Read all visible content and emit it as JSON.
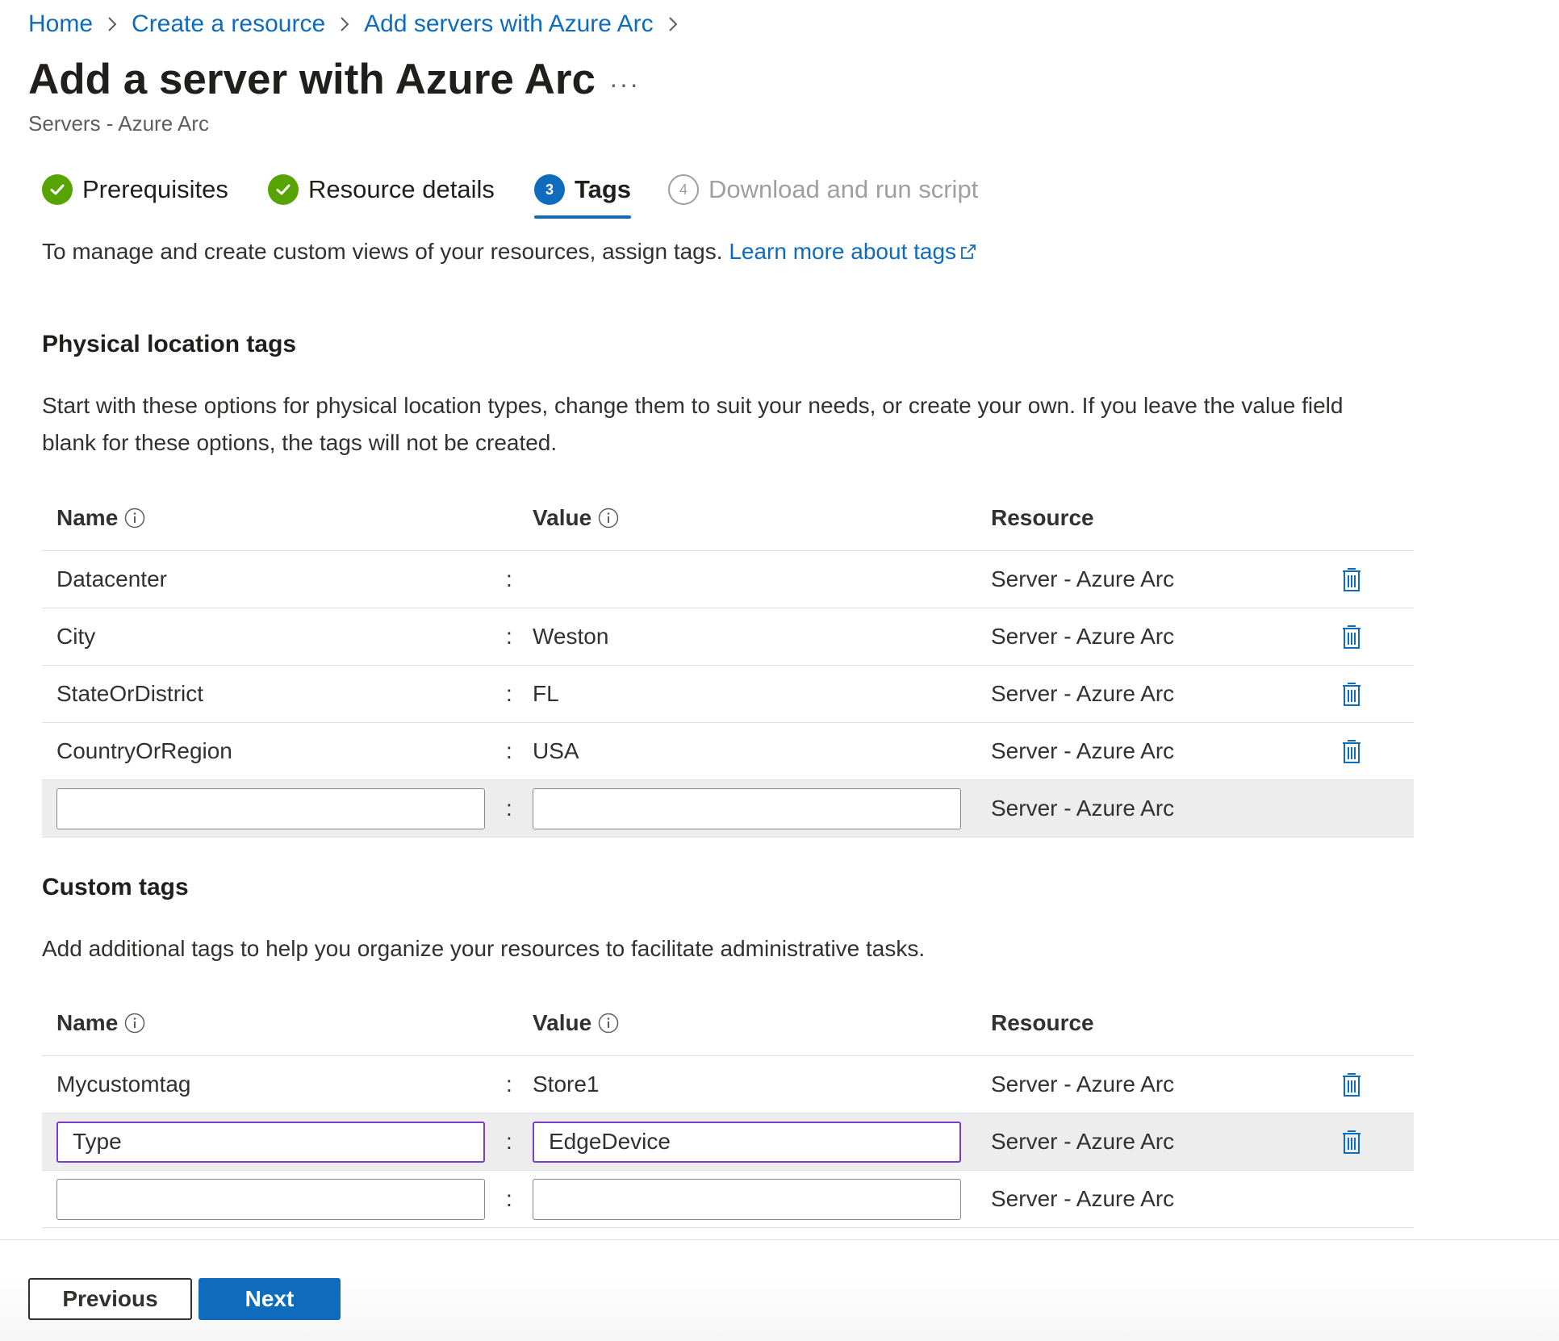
{
  "breadcrumb": {
    "items": [
      "Home",
      "Create a resource",
      "Add servers with Azure Arc"
    ]
  },
  "page": {
    "title": "Add a server with Azure Arc",
    "more": "···",
    "subtitle": "Servers - Azure Arc"
  },
  "steps": [
    {
      "label": "Prerequisites",
      "state": "done"
    },
    {
      "label": "Resource details",
      "state": "done"
    },
    {
      "label": "Tags",
      "state": "active",
      "number": "3"
    },
    {
      "label": "Download and run script",
      "state": "pending",
      "number": "4"
    }
  ],
  "intro": {
    "text": "To manage and create custom views of your resources, assign tags.",
    "link": "Learn more about tags"
  },
  "physical": {
    "title": "Physical location tags",
    "description": "Start with these options for physical location types, change them to suit your needs, or create your own. If you leave the value field blank for these options, the tags will not be created.",
    "headers": {
      "name": "Name",
      "value": "Value",
      "resource": "Resource"
    },
    "rows": [
      {
        "name": "Datacenter",
        "value": "",
        "resource": "Server - Azure Arc"
      },
      {
        "name": "City",
        "value": "Weston",
        "resource": "Server - Azure Arc"
      },
      {
        "name": "StateOrDistrict",
        "value": "FL",
        "resource": "Server - Azure Arc"
      },
      {
        "name": "CountryOrRegion",
        "value": "USA",
        "resource": "Server - Azure Arc"
      }
    ],
    "new_row": {
      "name": "",
      "value": "",
      "resource": "Server - Azure Arc"
    }
  },
  "custom": {
    "title": "Custom tags",
    "description": "Add additional tags to help you organize your resources to facilitate administrative tasks.",
    "headers": {
      "name": "Name",
      "value": "Value",
      "resource": "Resource"
    },
    "rows": [
      {
        "name": "Mycustomtag",
        "value": "Store1",
        "resource": "Server - Azure Arc"
      }
    ],
    "edit_row": {
      "name": "Type",
      "value": "EdgeDevice",
      "resource": "Server - Azure Arc"
    },
    "new_row": {
      "name": "",
      "value": "",
      "resource": "Server - Azure Arc"
    }
  },
  "colon": ":",
  "footer": {
    "previous": "Previous",
    "next": "Next"
  },
  "colors": {
    "link": "#0f6cbd",
    "done": "#57a300",
    "active": "#0f6cbd",
    "focus_border": "#7a3ec5",
    "primary_button": "#0f6cbd"
  },
  "icons": {
    "done_step": "checkmark-circle-icon",
    "info": "info-icon",
    "delete": "trash-icon",
    "external": "external-link-icon",
    "breadcrumb_separator": "chevron-right-icon"
  }
}
